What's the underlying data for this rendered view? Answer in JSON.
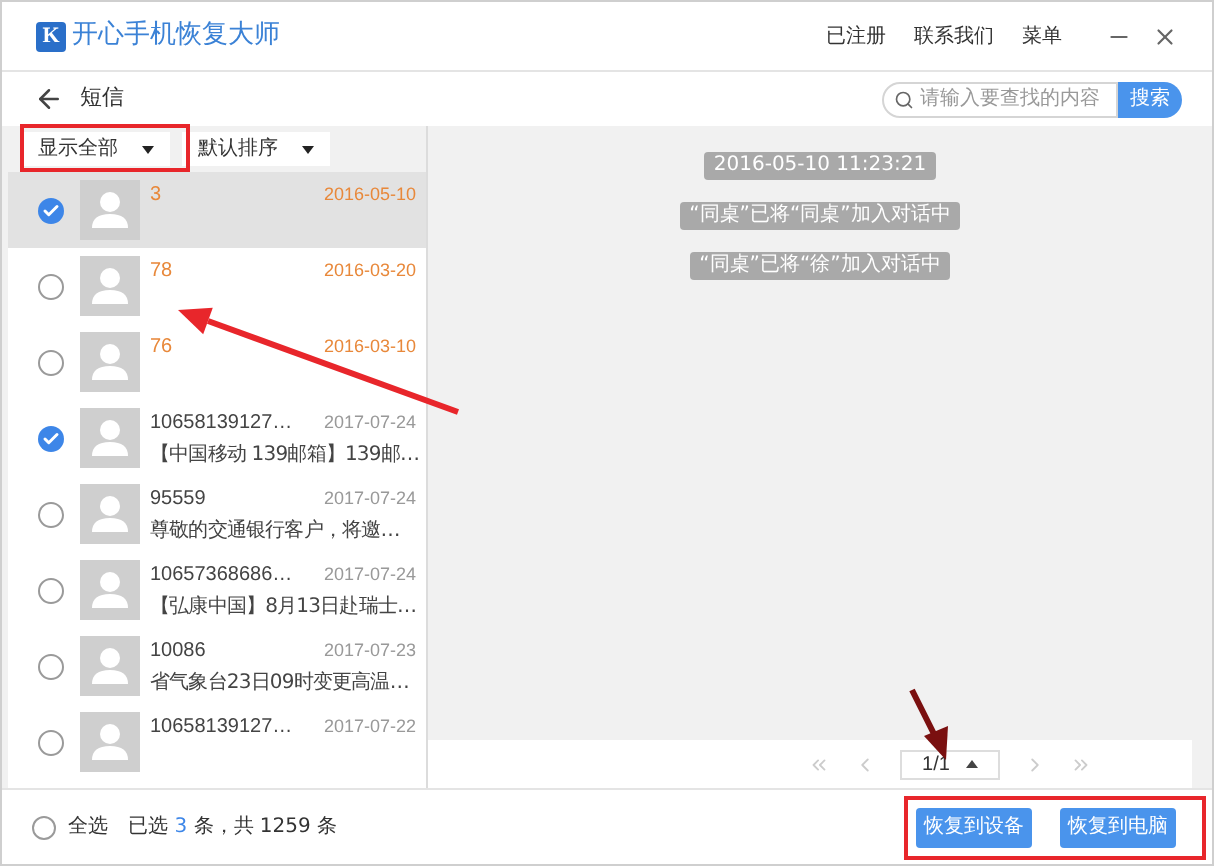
{
  "app": {
    "logo_letter": "K",
    "title": "开心手机恢复大师",
    "menu": [
      "已注册",
      "联系我们",
      "菜单"
    ]
  },
  "toolbar": {
    "title": "短信",
    "search": {
      "placeholder": "请输入要查找的内容",
      "button": "搜索"
    }
  },
  "filters": [
    {
      "label": "显示全部"
    },
    {
      "label": "默认排序"
    }
  ],
  "conversations": [
    {
      "name": "3",
      "date": "2016-05-10",
      "kind": "deleted",
      "selected": true,
      "highlighted": true
    },
    {
      "name": "78",
      "date": "2016-03-20",
      "kind": "deleted",
      "selected": false,
      "highlighted": false
    },
    {
      "name": "76",
      "date": "2016-03-10",
      "kind": "deleted",
      "selected": false,
      "highlighted": false
    },
    {
      "name": "10658139127…",
      "date": "2017-07-24",
      "preview": "【中国移动 139邮箱】139邮…",
      "kind": "normal",
      "selected": true,
      "highlighted": false
    },
    {
      "name": "95559",
      "date": "2017-07-24",
      "preview": "尊敬的交通银行客户，将邀…",
      "kind": "normal",
      "selected": false,
      "highlighted": false
    },
    {
      "name": "10657368686…",
      "date": "2017-07-24",
      "preview": "【弘康中国】8月13日赴瑞士…",
      "kind": "normal",
      "selected": false,
      "highlighted": false
    },
    {
      "name": "10086",
      "date": "2017-07-23",
      "preview": "省气象台23日09时变更高温…",
      "kind": "normal",
      "selected": false,
      "highlighted": false
    },
    {
      "name": "10658139127…",
      "date": "2017-07-22",
      "kind": "normal",
      "selected": false,
      "highlighted": false
    }
  ],
  "messages": [
    "2016-05-10 11:23:21",
    "“同桌”已将“同桌”加入对话中",
    "“同桌”已将“徐”加入对话中"
  ],
  "pagination": {
    "page": "1/1"
  },
  "footer": {
    "select_all": {
      "label": "全选",
      "checked": false
    },
    "status_before": "已选",
    "count": "3",
    "status_after": "条，共 1259 条",
    "buttons": [
      "恢复到设备",
      "恢复到电脑"
    ]
  }
}
